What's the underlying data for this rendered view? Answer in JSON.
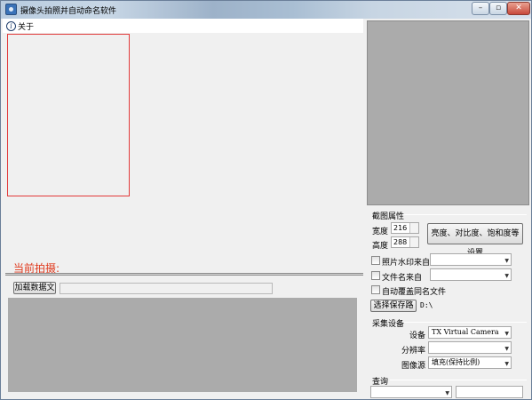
{
  "window": {
    "title": "摄像头拍照并自动命名软件",
    "min_glyph": "–",
    "max_glyph": "▫",
    "close_glyph": "✕"
  },
  "menu": {
    "about": "关于",
    "about_icon": "help-circle-icon"
  },
  "capture": {
    "current_label": "当前拍摄:"
  },
  "load": {
    "button": "加载数据文",
    "value": ""
  },
  "crop": {
    "title": "截图属性",
    "width_label": "宽度",
    "width_value": "216",
    "height_label": "高度",
    "height_value": "288",
    "settings_button": "亮度、对比度、饱和度等设置"
  },
  "options": {
    "watermark_label": "照片水印来自",
    "watermark_value": "",
    "filename_label": "文件名来自",
    "filename_value": "",
    "overwrite_label": "自动覆盖同名文件"
  },
  "save": {
    "button": "选择保存路",
    "path": "D:\\"
  },
  "device": {
    "title": "采集设备",
    "device_label": "设备",
    "device_value": "TX Virtual Camera",
    "resolution_label": "分辨率",
    "resolution_value": "",
    "source_label": "图像源",
    "source_value": "填充(保持比例)"
  },
  "query": {
    "title": "查询",
    "field_value": "",
    "input_value": ""
  },
  "colors": {
    "preview_border": "#e23a3a",
    "current_label": "#e03a1e",
    "video_area": "#ababab"
  }
}
